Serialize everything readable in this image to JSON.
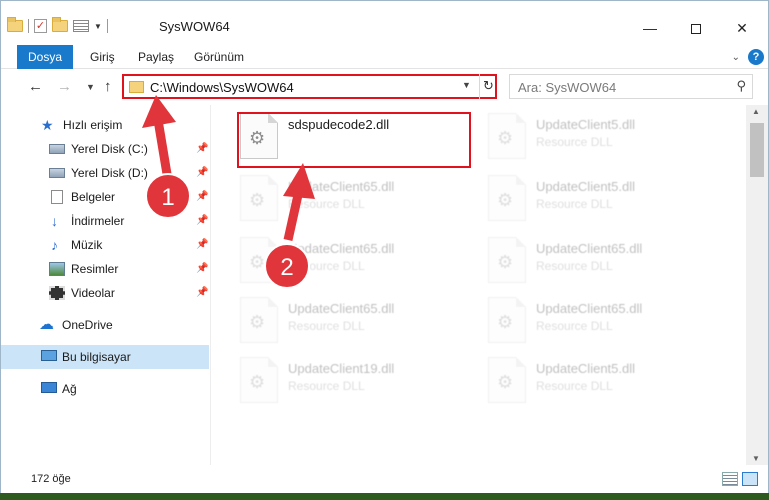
{
  "window": {
    "title": "SysWOW64",
    "controls": {
      "minimize": "—",
      "maximize": "",
      "close": "✕"
    }
  },
  "ribbon": {
    "tabs": [
      {
        "label": "Dosya"
      },
      {
        "label": "Giriş"
      },
      {
        "label": "Paylaş"
      },
      {
        "label": "Görünüm"
      }
    ]
  },
  "navbar": {
    "address": "C:\\Windows\\SysWOW64",
    "search_placeholder": "Ara: SysWOW64"
  },
  "sidebar": {
    "items": [
      {
        "label": "Hızlı erişim",
        "icon": "star-icon"
      },
      {
        "label": "Yerel Disk (C:)",
        "icon": "disk-icon",
        "pinned": true
      },
      {
        "label": "Yerel Disk (D:)",
        "icon": "disk-icon",
        "pinned": true
      },
      {
        "label": "Belgeler",
        "icon": "documents-icon",
        "pinned": true
      },
      {
        "label": "İndirmeler",
        "icon": "downloads-icon",
        "pinned": true
      },
      {
        "label": "Müzik",
        "icon": "music-icon",
        "pinned": true
      },
      {
        "label": "Resimler",
        "icon": "pictures-icon",
        "pinned": true
      },
      {
        "label": "Videolar",
        "icon": "videos-icon",
        "pinned": true
      },
      {
        "label": "OneDrive",
        "icon": "cloud-icon"
      },
      {
        "label": "Bu bilgisayar",
        "icon": "pc-icon",
        "selected": true
      },
      {
        "label": "Ağ",
        "icon": "network-icon"
      }
    ]
  },
  "files": [
    {
      "name": "sdspudecode2.dll",
      "type": "",
      "highlighted": true
    },
    {
      "name": "UpdateClient5.dll",
      "type": "Resource DLL"
    },
    {
      "name": "UpdateClient65.dll",
      "type": "Resource DLL"
    },
    {
      "name": "UpdateClient5.dll",
      "type": "Resource DLL"
    },
    {
      "name": "UpdateClient65.dll",
      "type": "Resource DLL"
    },
    {
      "name": "UpdateClient65.dll",
      "type": "Resource DLL"
    },
    {
      "name": "UpdateClient65.dll",
      "type": "Resource DLL"
    },
    {
      "name": "UpdateClient65.dll",
      "type": "Resource DLL"
    },
    {
      "name": "UpdateClient19.dll",
      "type": "Resource DLL"
    },
    {
      "name": "UpdateClient5.dll",
      "type": "Resource DLL"
    }
  ],
  "status": {
    "count": "172 öğe"
  },
  "annotations": [
    {
      "number": "1"
    },
    {
      "number": "2"
    }
  ],
  "colors": {
    "accent": "#1979ca",
    "highlight": "#e0121d",
    "selected": "#cce4f7"
  }
}
